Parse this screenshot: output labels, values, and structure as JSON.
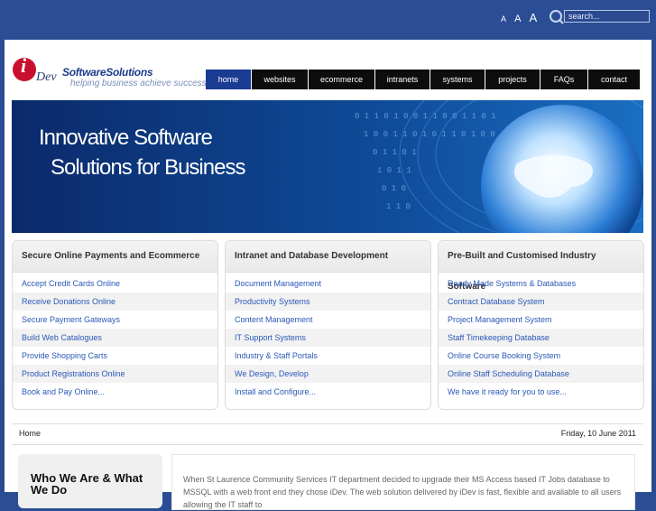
{
  "header": {
    "font_sizes": [
      "A",
      "A",
      "A"
    ],
    "search": {
      "placeholder": "search..."
    }
  },
  "logo": {
    "i": "i",
    "dev": "Dev",
    "title": "SoftwareSolutions",
    "tagline": "helping business achieve success"
  },
  "nav": [
    "home",
    "websites",
    "ecommerce",
    "intranets",
    "systems",
    "projects",
    "FAQs",
    "contact"
  ],
  "banner": {
    "line1": "Innovative Software",
    "line2": "Solutions for Business"
  },
  "panels": [
    {
      "title": "Secure Online Payments and Ecommerce",
      "items": [
        "Accept Credit Cards Online",
        "Receive Donations Online",
        "Secure Payment Gateways",
        "Build Web Catalogues",
        "Provide Shopping Carts",
        "Product Registrations Online",
        "Book and Pay Online..."
      ]
    },
    {
      "title": "Intranet and Database Development",
      "items": [
        "Document Management",
        "Productivity Systems",
        "Content Management",
        "IT Support Systems",
        "Industry & Staff Portals",
        "We Design, Develop",
        "Install and Configure..."
      ]
    },
    {
      "title": "Pre-Built and Customised Industry Software",
      "items": [
        "Ready Made Systems & Databases",
        "Contract Database System",
        "Project Management System",
        "Staff Timekeeping Database",
        "Online Course Booking System",
        "Online Staff Scheduling Database",
        "We have it ready for you to use..."
      ]
    }
  ],
  "breadcrumb": "Home",
  "date": "Friday, 10 June 2011",
  "who": {
    "title": "Who We Are & What We Do"
  },
  "content": {
    "text": "When St Laurence Community Services IT department decided to upgrade their MS Access based IT Jobs database to MSSQL with a web front end they chose iDev. The web solution delivered by iDev is fast, flexible and available to all users allowing the IT staff to"
  },
  "colors": {
    "background": "#2d4a8e",
    "nav_active": "#1b3c93",
    "nav": "#0d0d0d",
    "link": "#2a58b7"
  }
}
